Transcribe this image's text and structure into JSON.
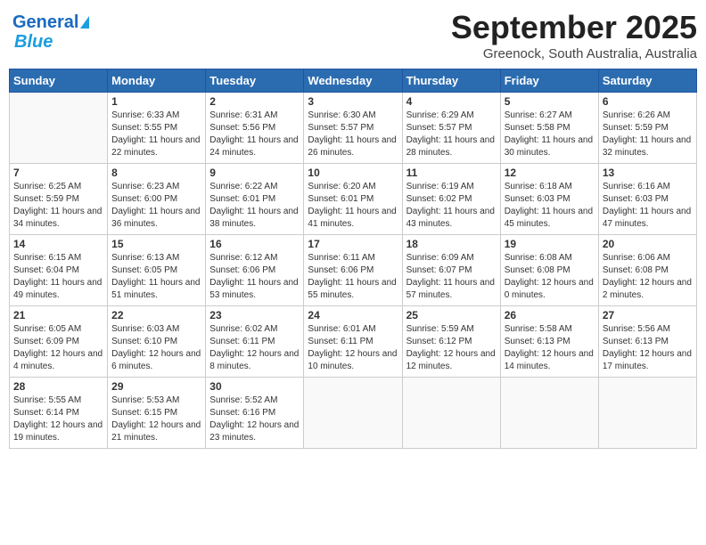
{
  "header": {
    "logo_line1": "General",
    "logo_line2": "Blue",
    "month": "September 2025",
    "location": "Greenock, South Australia, Australia"
  },
  "days_of_week": [
    "Sunday",
    "Monday",
    "Tuesday",
    "Wednesday",
    "Thursday",
    "Friday",
    "Saturday"
  ],
  "weeks": [
    [
      {
        "day": "",
        "sunrise": "",
        "sunset": "",
        "daylight": ""
      },
      {
        "day": "1",
        "sunrise": "6:33 AM",
        "sunset": "5:55 PM",
        "daylight": "11 hours and 22 minutes."
      },
      {
        "day": "2",
        "sunrise": "6:31 AM",
        "sunset": "5:56 PM",
        "daylight": "11 hours and 24 minutes."
      },
      {
        "day": "3",
        "sunrise": "6:30 AM",
        "sunset": "5:57 PM",
        "daylight": "11 hours and 26 minutes."
      },
      {
        "day": "4",
        "sunrise": "6:29 AM",
        "sunset": "5:57 PM",
        "daylight": "11 hours and 28 minutes."
      },
      {
        "day": "5",
        "sunrise": "6:27 AM",
        "sunset": "5:58 PM",
        "daylight": "11 hours and 30 minutes."
      },
      {
        "day": "6",
        "sunrise": "6:26 AM",
        "sunset": "5:59 PM",
        "daylight": "11 hours and 32 minutes."
      }
    ],
    [
      {
        "day": "7",
        "sunrise": "6:25 AM",
        "sunset": "5:59 PM",
        "daylight": "11 hours and 34 minutes."
      },
      {
        "day": "8",
        "sunrise": "6:23 AM",
        "sunset": "6:00 PM",
        "daylight": "11 hours and 36 minutes."
      },
      {
        "day": "9",
        "sunrise": "6:22 AM",
        "sunset": "6:01 PM",
        "daylight": "11 hours and 38 minutes."
      },
      {
        "day": "10",
        "sunrise": "6:20 AM",
        "sunset": "6:01 PM",
        "daylight": "11 hours and 41 minutes."
      },
      {
        "day": "11",
        "sunrise": "6:19 AM",
        "sunset": "6:02 PM",
        "daylight": "11 hours and 43 minutes."
      },
      {
        "day": "12",
        "sunrise": "6:18 AM",
        "sunset": "6:03 PM",
        "daylight": "11 hours and 45 minutes."
      },
      {
        "day": "13",
        "sunrise": "6:16 AM",
        "sunset": "6:03 PM",
        "daylight": "11 hours and 47 minutes."
      }
    ],
    [
      {
        "day": "14",
        "sunrise": "6:15 AM",
        "sunset": "6:04 PM",
        "daylight": "11 hours and 49 minutes."
      },
      {
        "day": "15",
        "sunrise": "6:13 AM",
        "sunset": "6:05 PM",
        "daylight": "11 hours and 51 minutes."
      },
      {
        "day": "16",
        "sunrise": "6:12 AM",
        "sunset": "6:06 PM",
        "daylight": "11 hours and 53 minutes."
      },
      {
        "day": "17",
        "sunrise": "6:11 AM",
        "sunset": "6:06 PM",
        "daylight": "11 hours and 55 minutes."
      },
      {
        "day": "18",
        "sunrise": "6:09 AM",
        "sunset": "6:07 PM",
        "daylight": "11 hours and 57 minutes."
      },
      {
        "day": "19",
        "sunrise": "6:08 AM",
        "sunset": "6:08 PM",
        "daylight": "12 hours and 0 minutes."
      },
      {
        "day": "20",
        "sunrise": "6:06 AM",
        "sunset": "6:08 PM",
        "daylight": "12 hours and 2 minutes."
      }
    ],
    [
      {
        "day": "21",
        "sunrise": "6:05 AM",
        "sunset": "6:09 PM",
        "daylight": "12 hours and 4 minutes."
      },
      {
        "day": "22",
        "sunrise": "6:03 AM",
        "sunset": "6:10 PM",
        "daylight": "12 hours and 6 minutes."
      },
      {
        "day": "23",
        "sunrise": "6:02 AM",
        "sunset": "6:11 PM",
        "daylight": "12 hours and 8 minutes."
      },
      {
        "day": "24",
        "sunrise": "6:01 AM",
        "sunset": "6:11 PM",
        "daylight": "12 hours and 10 minutes."
      },
      {
        "day": "25",
        "sunrise": "5:59 AM",
        "sunset": "6:12 PM",
        "daylight": "12 hours and 12 minutes."
      },
      {
        "day": "26",
        "sunrise": "5:58 AM",
        "sunset": "6:13 PM",
        "daylight": "12 hours and 14 minutes."
      },
      {
        "day": "27",
        "sunrise": "5:56 AM",
        "sunset": "6:13 PM",
        "daylight": "12 hours and 17 minutes."
      }
    ],
    [
      {
        "day": "28",
        "sunrise": "5:55 AM",
        "sunset": "6:14 PM",
        "daylight": "12 hours and 19 minutes."
      },
      {
        "day": "29",
        "sunrise": "5:53 AM",
        "sunset": "6:15 PM",
        "daylight": "12 hours and 21 minutes."
      },
      {
        "day": "30",
        "sunrise": "5:52 AM",
        "sunset": "6:16 PM",
        "daylight": "12 hours and 23 minutes."
      },
      {
        "day": "",
        "sunrise": "",
        "sunset": "",
        "daylight": ""
      },
      {
        "day": "",
        "sunrise": "",
        "sunset": "",
        "daylight": ""
      },
      {
        "day": "",
        "sunrise": "",
        "sunset": "",
        "daylight": ""
      },
      {
        "day": "",
        "sunrise": "",
        "sunset": "",
        "daylight": ""
      }
    ]
  ]
}
